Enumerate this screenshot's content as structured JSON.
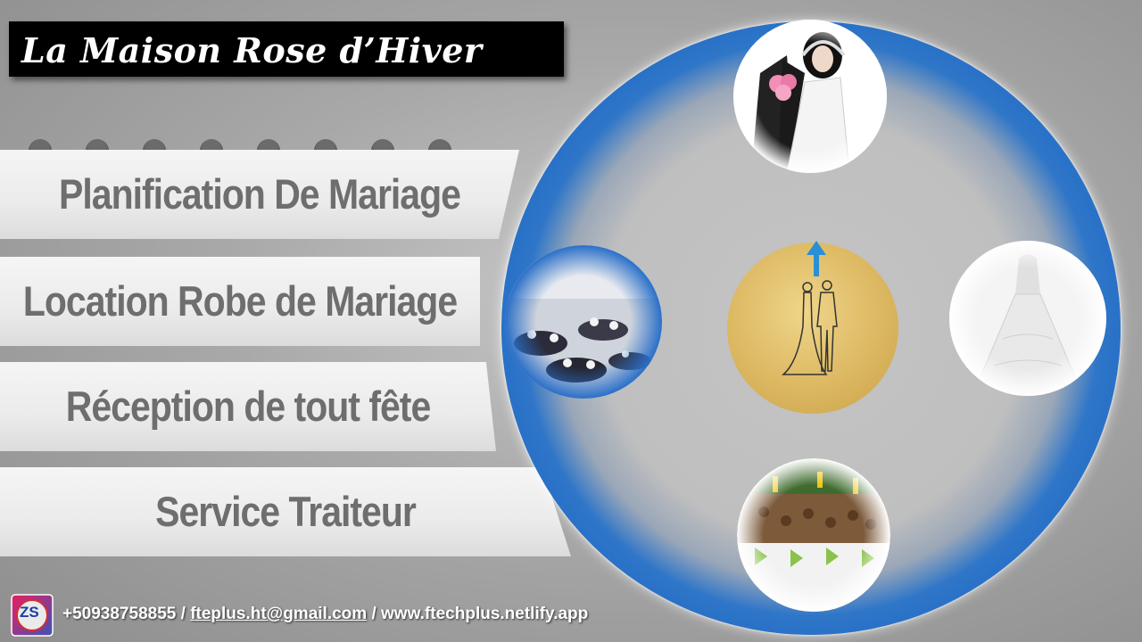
{
  "title": "La Maison Rose d’Hiver",
  "services": [
    {
      "label": "Planification De Mariage"
    },
    {
      "label": "Location Robe de Mariage"
    },
    {
      "label": "Réception de tout fête"
    },
    {
      "label": "Service Traiteur"
    }
  ],
  "photos": {
    "top": "bride-groom-photo",
    "left": "reception-hall-photo",
    "right": "wedding-dress-photo",
    "bottom": "catering-table-photo"
  },
  "center_icon": "couple-icon",
  "footer": {
    "logo_text": "ZS",
    "phone": "+50938758855",
    "sep1": " / ",
    "email": "fteplus.ht@gmail.com",
    "sep2": " / ",
    "website": "www.ftechplus.netlify.app"
  },
  "colors": {
    "ring_blue": "#1a66c4",
    "gold": "#dcb861",
    "band_text": "#6e6e6e"
  }
}
